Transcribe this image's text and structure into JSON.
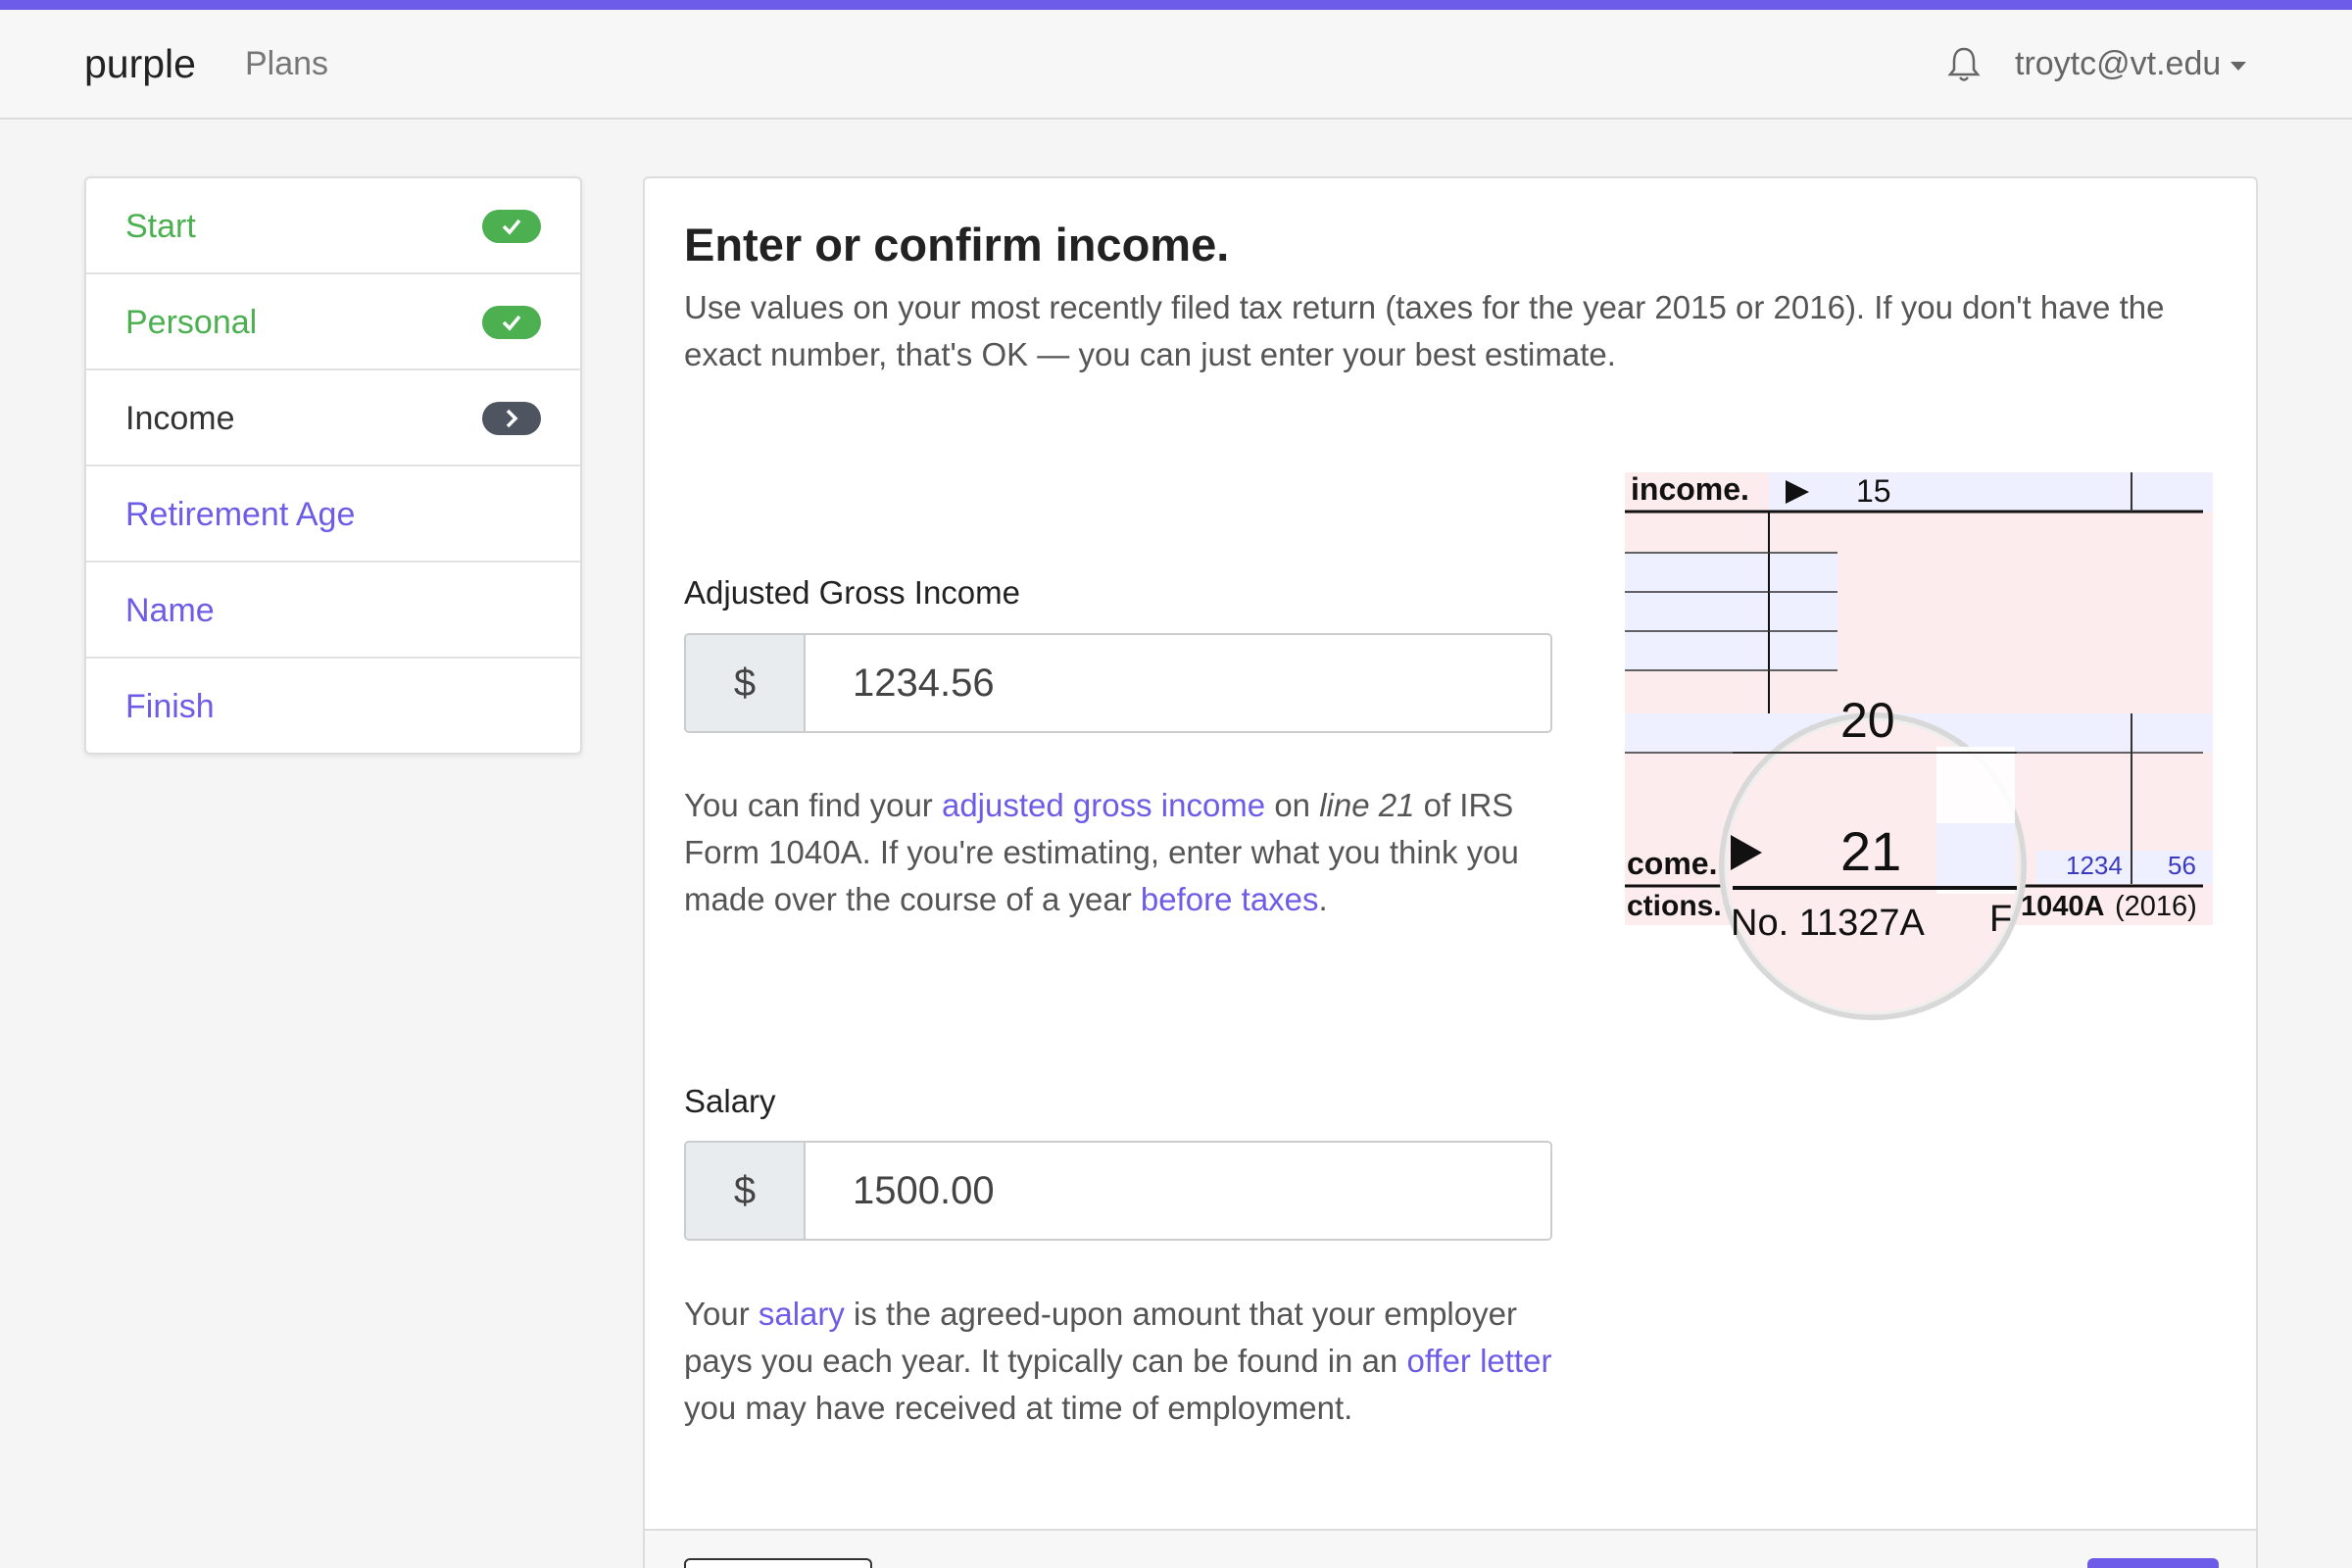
{
  "navbar": {
    "brand": "purple",
    "plans_link": "Plans",
    "user_email": "troytc@vt.edu"
  },
  "sidebar": {
    "items": [
      {
        "label": "Start",
        "status": "done"
      },
      {
        "label": "Personal",
        "status": "done"
      },
      {
        "label": "Income",
        "status": "current"
      },
      {
        "label": "Retirement Age",
        "status": "todo"
      },
      {
        "label": "Name",
        "status": "todo"
      },
      {
        "label": "Finish",
        "status": "todo"
      }
    ]
  },
  "main": {
    "title": "Enter or confirm income.",
    "intro": "Use values on your most recently filed tax return (taxes for the year 2015 or 2016). If you don't have the exact number, that's OK — you can just enter your best estimate.",
    "agi": {
      "label": "Adjusted Gross Income",
      "currency": "$",
      "value": "1234.56",
      "help_1": "You can find your ",
      "help_link_1": "adjusted gross income",
      "help_2": " on ",
      "help_line": "line 21",
      "help_3": " of IRS Form 1040A. If you're estimating, enter what you think you made over the course of a year ",
      "help_link_2": "before taxes",
      "help_4": "."
    },
    "salary": {
      "label": "Salary",
      "currency": "$",
      "value": "1500.00",
      "help_1": "Your ",
      "help_link_1": "salary",
      "help_2": " is the agreed-upon amount that your employer pays you each year. It typically can be found in an ",
      "help_link_2": "offer letter",
      "help_3": " you may have received at time of employment."
    },
    "form_image": {
      "top_label": "income.",
      "top_line": "15",
      "line_20": "20",
      "line_21": "21",
      "side_label_1": "come.",
      "side_label_2": "ctions.",
      "cat_no": "No. 11327A",
      "letter_f": "F",
      "amount_dollars": "1234",
      "amount_cents": "56",
      "form_name": "1040A",
      "form_year": "(2016)"
    }
  },
  "colors": {
    "accent": "#6c5ce7",
    "done": "#4caf50",
    "current": "#4f5560"
  }
}
